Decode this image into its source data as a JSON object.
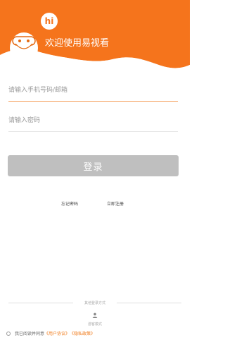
{
  "header": {
    "welcome_text": "欢迎使用易视看",
    "mascot_badge": "hi",
    "brand_color": "#f5741c"
  },
  "login_form": {
    "account_placeholder": "请输入手机号码/邮箱",
    "password_placeholder": "请输入密码",
    "login_label": "登录",
    "accent_line_color": "#f5a05c"
  },
  "links": {
    "forgot_password": "忘记密码",
    "register_now": "立即注册"
  },
  "other_login": {
    "label": "其他登录方式",
    "guest_label": "游客模式",
    "guest_icon": "person-icon"
  },
  "agreement": {
    "prefix": "我已阅读并同意",
    "user_agreement": "《用户协议》",
    "privacy_policy": "《隐私政策》"
  }
}
